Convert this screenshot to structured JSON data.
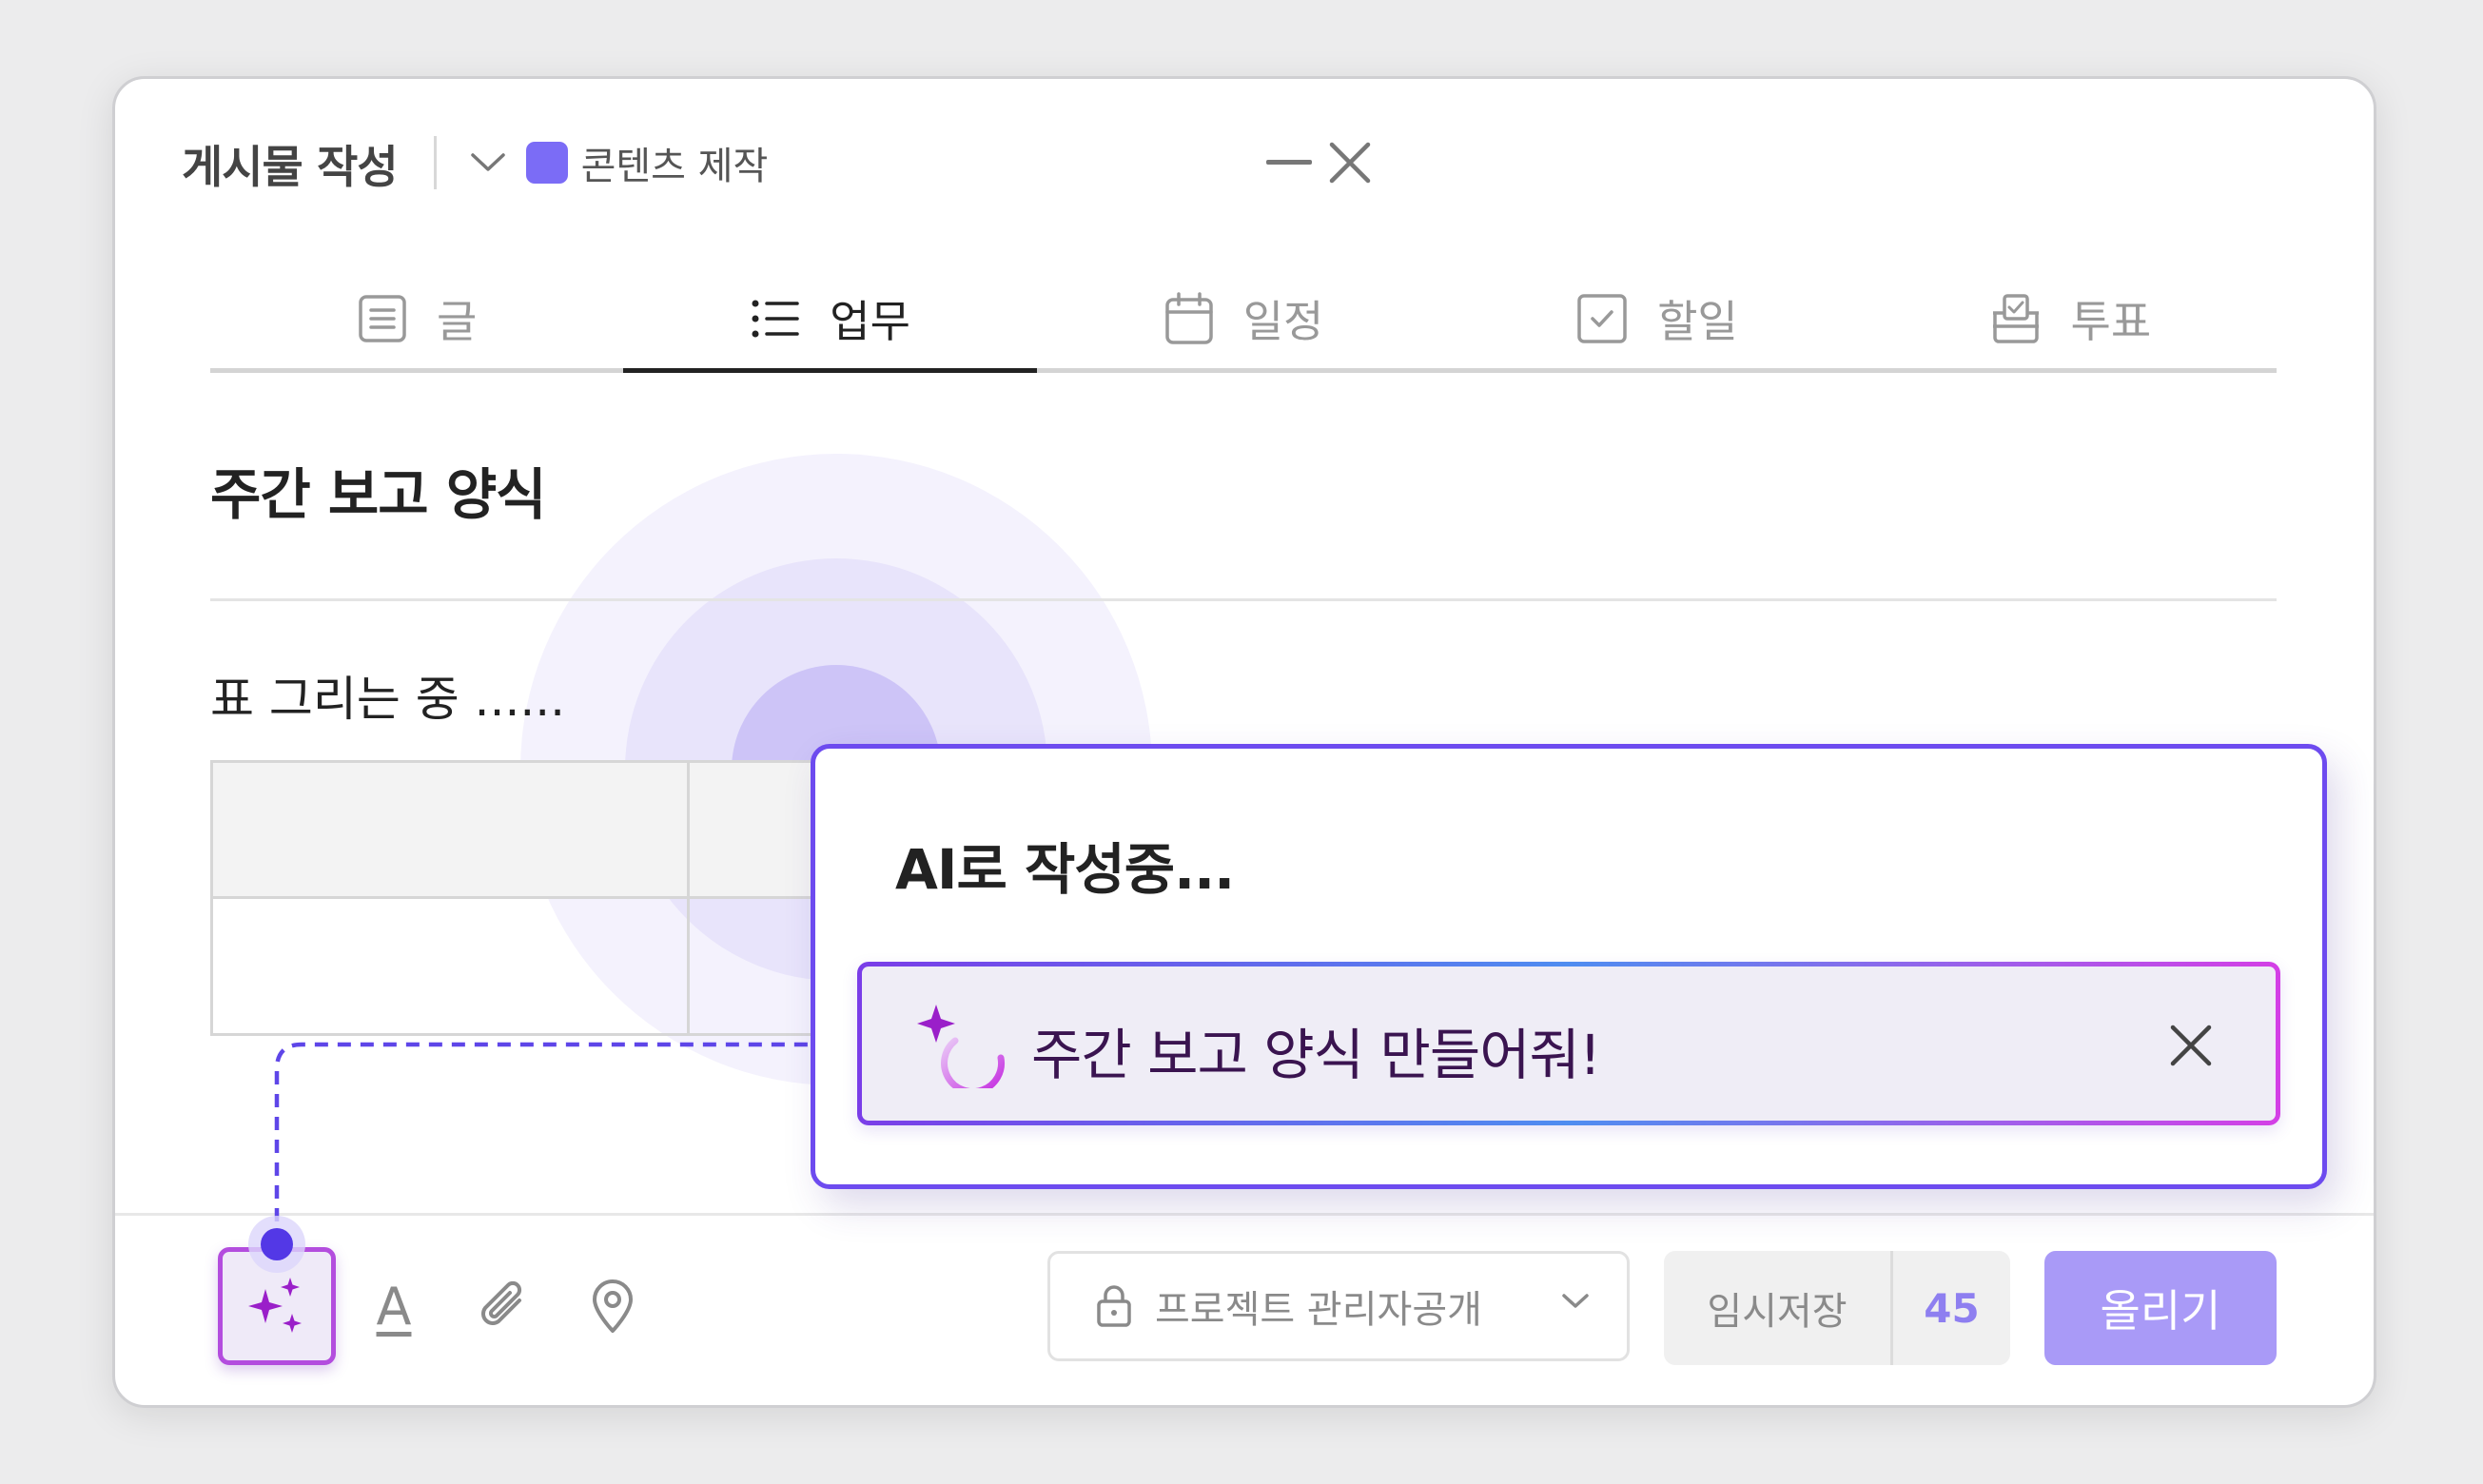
{
  "header": {
    "title": "게시물 작성",
    "project_name": "콘텐츠 제작",
    "project_color": "#7b6cf6"
  },
  "tabs": [
    {
      "label": "글",
      "icon": "document-icon",
      "active": false
    },
    {
      "label": "업무",
      "icon": "list-icon",
      "active": true
    },
    {
      "label": "일정",
      "icon": "calendar-icon",
      "active": false
    },
    {
      "label": "할일",
      "icon": "checkbox-icon",
      "active": false
    },
    {
      "label": "투표",
      "icon": "ballot-icon",
      "active": false
    }
  ],
  "post": {
    "title": "주간 보고 양식",
    "status": "표 그리는 중 ......"
  },
  "ai_panel": {
    "heading": "AI로 작성중...",
    "prompt": "주간 보고 양식 만들어줘!",
    "accent": "#6d4bef"
  },
  "footer": {
    "text_tool_label": "A",
    "visibility_label": "프로젝트 관리자공개",
    "draft_label": "임시저장",
    "draft_count": "45",
    "post_label": "올리기",
    "post_color": "#a99af7"
  }
}
